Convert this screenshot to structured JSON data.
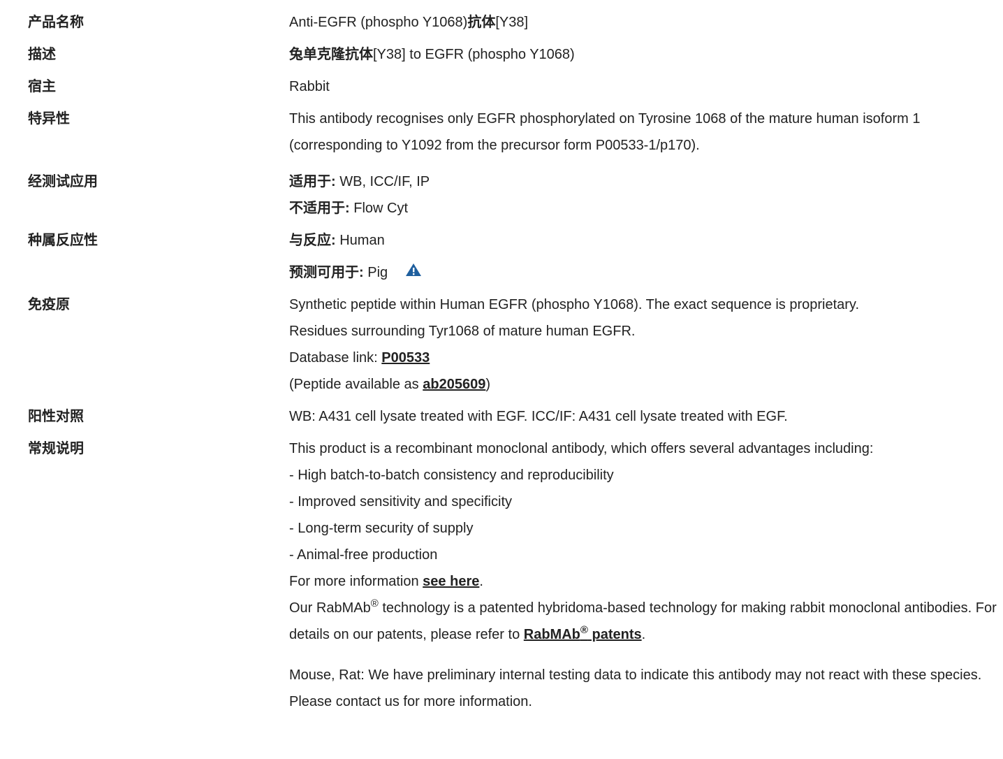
{
  "rows": {
    "product_name": {
      "label": "产品名称",
      "value_prefix": "Anti-EGFR (phospho Y1068)",
      "value_bold": "抗体",
      "value_suffix": "[Y38]"
    },
    "description": {
      "label": "描述",
      "value_bold": "兔单克隆抗体",
      "value_suffix": "[Y38] to EGFR (phospho Y1068)"
    },
    "host": {
      "label": "宿主",
      "value": "Rabbit"
    },
    "specificity": {
      "label": "特异性",
      "value": "This antibody recognises only EGFR phosphorylated on Tyrosine 1068 of the mature human isoform 1 (corresponding to Y1092 from the precursor form P00533-1/p170)."
    },
    "tested_applications": {
      "label": "经测试应用",
      "suitable_label": "适用于:",
      "suitable_value": " WB, ICC/IF, IP",
      "unsuitable_label": "不适用于:",
      "unsuitable_value": " Flow Cyt"
    },
    "species_reactivity": {
      "label": "种属反应性",
      "reacts_label": "与反应:",
      "reacts_value": " Human",
      "predicted_label": "预测可用于:",
      "predicted_value": " Pig",
      "warning_icon": "warning-triangle-icon"
    },
    "immunogen": {
      "label": "免疫原",
      "line1": "Synthetic peptide within Human EGFR (phospho Y1068). The exact sequence is proprietary.",
      "line2": "Residues surrounding Tyr1068 of mature human EGFR.",
      "db_prefix": "Database link: ",
      "db_link": "P00533",
      "peptide_prefix": "(Peptide available as ",
      "peptide_link": "ab205609",
      "peptide_suffix": ")"
    },
    "positive_control": {
      "label": "阳性对照",
      "value": "WB: A431 cell lysate treated with EGF. ICC/IF: A431 cell lysate treated with EGF."
    },
    "general_notes": {
      "label": "常规说明",
      "intro": "This product is a recombinant monoclonal antibody, which offers several advantages including:",
      "bullets": [
        "- High batch-to-batch consistency and reproducibility",
        "- Improved sensitivity and specificity",
        "- Long-term security of supply",
        "- Animal-free production"
      ],
      "more_info_prefix": "For more information ",
      "more_info_link": "see here",
      "more_info_suffix": ".",
      "rabmab_text1": "Our RabMAb",
      "rabmab_reg": "®",
      "rabmab_text2": " technology is a patented hybridoma-based technology for making rabbit monoclonal antibodies. For details on our patents, please refer to ",
      "patents_link_a": "RabMAb",
      "patents_link_reg": "®",
      "patents_link_b": " patents",
      "patents_suffix": ".",
      "mouse_rat_note": "Mouse, Rat: We have preliminary internal testing data to indicate this antibody may not react with these species. Please contact us for more information."
    }
  },
  "colors": {
    "text": "#222222",
    "warning_icon": "#1f5f9e"
  }
}
